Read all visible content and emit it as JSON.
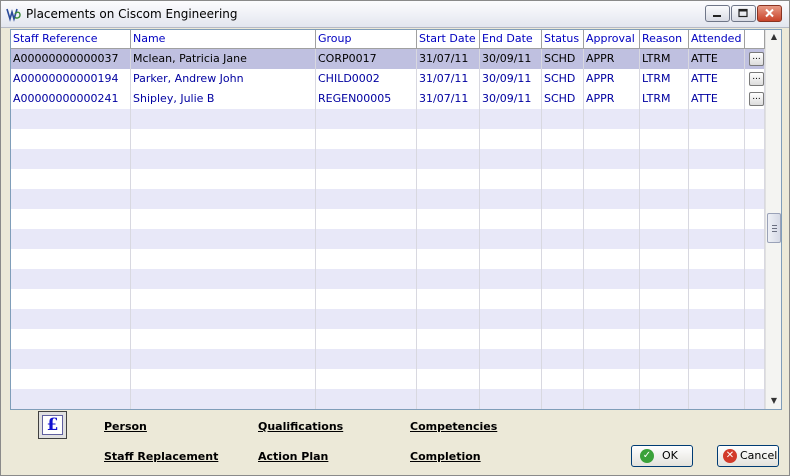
{
  "window": {
    "title": "Placements on Ciscom Engineering"
  },
  "columns": [
    "Staff Reference",
    "Name",
    "Group",
    "Start Date",
    "End Date",
    "Status",
    "Approval",
    "Reason",
    "Attended"
  ],
  "rows": [
    [
      "A00000000000037",
      "Mclean, Patricia Jane",
      "CORP0017",
      "31/07/11",
      "30/09/11",
      "SCHD",
      "APPR",
      "LTRM",
      "ATTE"
    ],
    [
      "A00000000000194",
      "Parker, Andrew John",
      "CHILD0002",
      "31/07/11",
      "30/09/11",
      "SCHD",
      "APPR",
      "LTRM",
      "ATTE"
    ],
    [
      "A00000000000241",
      "Shipley, Julie B",
      "REGEN00005",
      "31/07/11",
      "30/09/11",
      "SCHD",
      "APPR",
      "LTRM",
      "ATTE"
    ]
  ],
  "row_action_label": "...",
  "pound_label": "£",
  "links": {
    "person": "Person",
    "qualifications": "Qualifications",
    "competencies": "Competencies",
    "staff_replacement": "Staff Replacement",
    "action_plan": "Action Plan",
    "completion": "Completion"
  },
  "buttons": {
    "ok": "OK",
    "cancel": "Cancel"
  },
  "icons": {
    "app": "app-logo-icon",
    "minimize": "minimize-icon",
    "maximize": "maximize-icon",
    "close": "close-icon",
    "ok": "checkmark-icon",
    "cancel": "cancel-x-icon"
  },
  "colors": {
    "header_text": "#0000c0",
    "selected_row": "#bfc0e0",
    "alt_row": "#e8e8f8",
    "link_text": "#0000a0"
  }
}
